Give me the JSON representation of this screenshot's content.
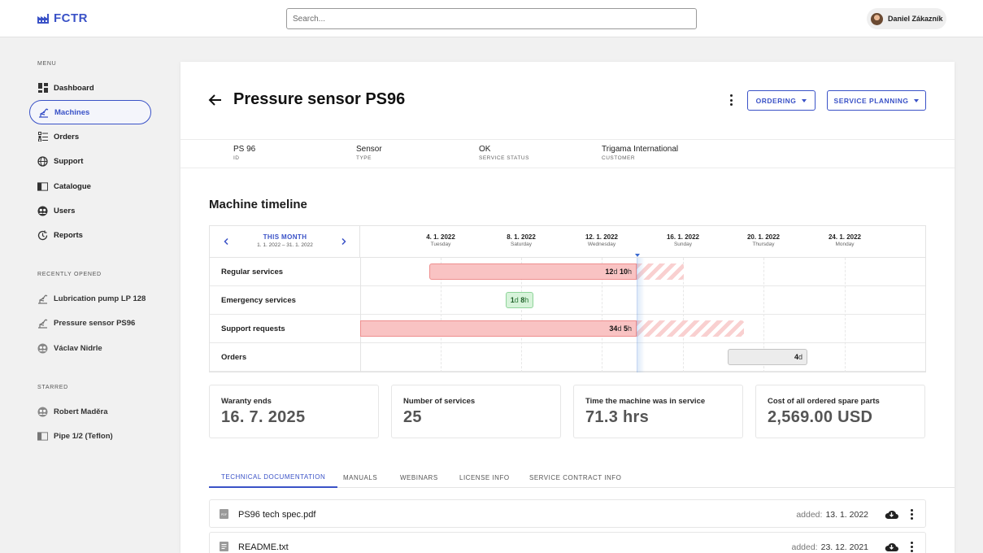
{
  "header": {
    "logo_text": "FCTR",
    "search_placeholder": "Search...",
    "user_name": "Daniel Zákazník"
  },
  "sidebar": {
    "menu_heading": "MENU",
    "items": [
      {
        "label": "Dashboard",
        "icon": "dashboard-icon"
      },
      {
        "label": "Machines",
        "icon": "machine-icon",
        "active": true
      },
      {
        "label": "Orders",
        "icon": "orders-icon"
      },
      {
        "label": "Support",
        "icon": "support-icon"
      },
      {
        "label": "Catalogue",
        "icon": "catalogue-icon"
      },
      {
        "label": "Users",
        "icon": "users-icon"
      },
      {
        "label": "Reports",
        "icon": "reports-icon"
      }
    ],
    "recent_heading": "RECENTLY OPENED",
    "recent": [
      {
        "label": "Lubrication pump LP 128",
        "icon": "machine-icon"
      },
      {
        "label": "Pressure sensor PS96",
        "icon": "machine-icon"
      },
      {
        "label": "Václav Nidrle",
        "icon": "user-icon"
      }
    ],
    "starred_heading": "STARRED",
    "starred": [
      {
        "label": "Robert Maděra",
        "icon": "user-icon"
      },
      {
        "label": "Pipe 1/2 (Teflon)",
        "icon": "catalogue-icon"
      }
    ]
  },
  "page": {
    "title": "Pressure sensor PS96",
    "ordering_label": "ORDERING",
    "service_planning_label": "SERVICE PLANNING",
    "info": [
      {
        "value": "PS 96",
        "label": "ID"
      },
      {
        "value": "Sensor",
        "label": "TYPE"
      },
      {
        "value": "OK",
        "label": "SERVICE STATUS"
      },
      {
        "value": "Trigama International",
        "label": "CUSTOMER"
      }
    ]
  },
  "timeline": {
    "section_title": "Machine timeline",
    "period_label": "THIS MONTH",
    "period_range": "1. 1. 2022 – 31. 1. 2022",
    "dates": [
      {
        "date": "4. 1. 2022",
        "weekday": "Tuesday"
      },
      {
        "date": "8. 1. 2022",
        "weekday": "Saturday"
      },
      {
        "date": "12. 1. 2022",
        "weekday": "Wednesday"
      },
      {
        "date": "16. 1. 2022",
        "weekday": "Sunday"
      },
      {
        "date": "20. 1. 2022",
        "weekday": "Thursday"
      },
      {
        "date": "24. 1. 2022",
        "weekday": "Monday"
      }
    ],
    "rows": [
      {
        "label": "Regular services",
        "bar": {
          "num1": "12",
          "unit1": "d",
          "num2": "10",
          "unit2": "h"
        }
      },
      {
        "label": "Emergency services",
        "bar": {
          "num1": "1",
          "unit1": "d",
          "num2": "8",
          "unit2": "h"
        }
      },
      {
        "label": "Support requests",
        "bar": {
          "num1": "34",
          "unit1": "d",
          "num2": "5",
          "unit2": "h"
        }
      },
      {
        "label": "Orders",
        "bar": {
          "num1": "4",
          "unit1": "d"
        }
      }
    ]
  },
  "stats": [
    {
      "label": "Waranty ends",
      "value": "16. 7. 2025"
    },
    {
      "label": "Number of services",
      "value": "25"
    },
    {
      "label": "Time the machine was in service",
      "value": "71.3 hrs"
    },
    {
      "label": "Cost of all ordered spare parts",
      "value": "2,569.00 USD"
    }
  ],
  "tabs": [
    {
      "label": "TECHNICAL DOCUMENTATION",
      "active": true
    },
    {
      "label": "MANUALS"
    },
    {
      "label": "WEBINARS"
    },
    {
      "label": "LICENSE INFO"
    },
    {
      "label": "SERVICE CONTRACT INFO"
    }
  ],
  "files": [
    {
      "name": "PS96 tech spec.pdf",
      "added_label": "added:",
      "added_date": "13. 1. 2022",
      "icon": "pdf-file-icon"
    },
    {
      "name": "README.txt",
      "added_label": "added:",
      "added_date": "23. 12. 2021",
      "icon": "text-file-icon"
    }
  ],
  "colors": {
    "accent": "#3a52c7",
    "bar_red": "#f9c3c3",
    "bar_green": "#d7f3da",
    "bar_grey": "#ececec"
  }
}
